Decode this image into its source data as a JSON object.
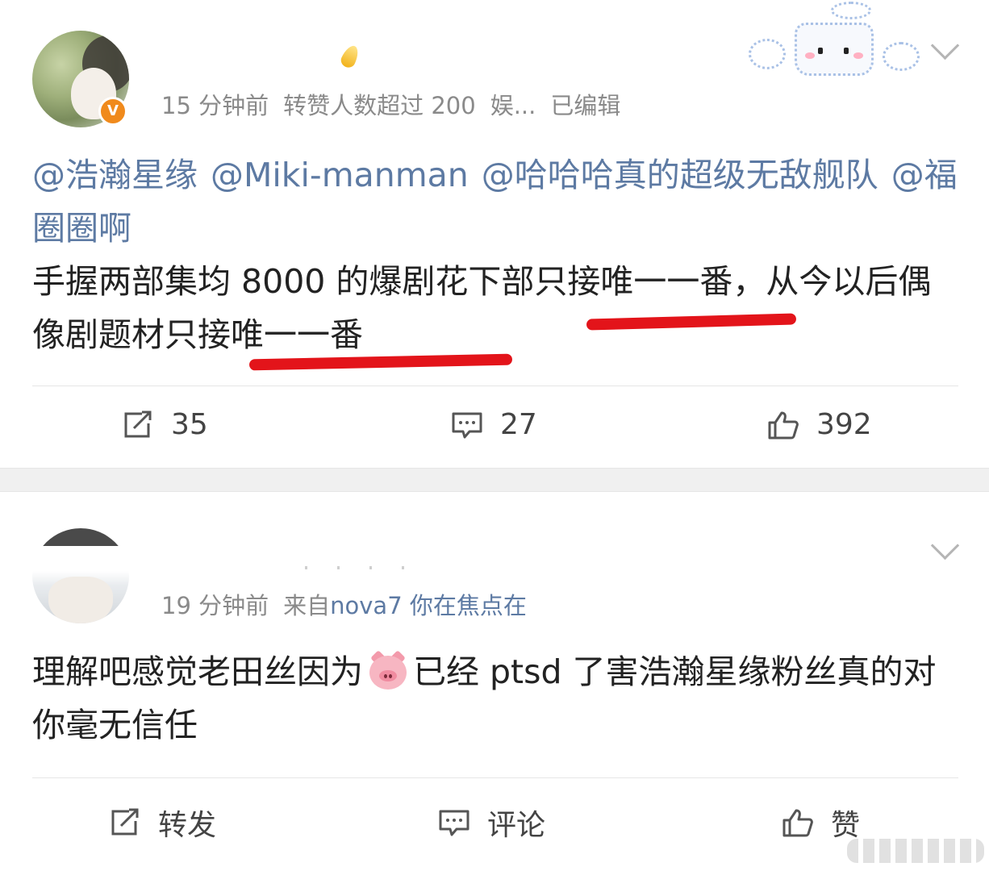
{
  "post1": {
    "meta": {
      "time": "15 分钟前",
      "tag": "转赞人数超过 200",
      "category": "娱...",
      "edited": "已编辑"
    },
    "mentions": [
      "@浩瀚星缘",
      "@Miki-manman",
      "@哈哈哈真的超级无敌舰队",
      "@福圈圈啊"
    ],
    "text": "手握两部集均 8000 的爆剧花下部只接唯一一番，从今以后偶像剧题材只接唯一一番",
    "actions": {
      "repost": "35",
      "comment": "27",
      "like": "392"
    },
    "badge": "V"
  },
  "post2": {
    "meta": {
      "time": "19 分钟前",
      "source_prefix": "来自",
      "source": "nova7 你在焦点在"
    },
    "text_before_emoji": "理解吧感觉老田丝因为",
    "emoji": "pig-face",
    "text_after_emoji": "已经 ptsd 了害浩瀚星缘粉丝真的对你毫无信任",
    "actions": {
      "repost": "转发",
      "comment": "评论",
      "like": "赞"
    }
  },
  "colors": {
    "link": "#5d7aa3",
    "meta": "#8a8a8a",
    "underline": "#e3141a",
    "badge": "#f08a1c",
    "separator": "#f0f0f0"
  },
  "icons": [
    "repost-icon",
    "comment-icon",
    "like-icon",
    "chevron-down-icon",
    "verified-badge-icon"
  ]
}
